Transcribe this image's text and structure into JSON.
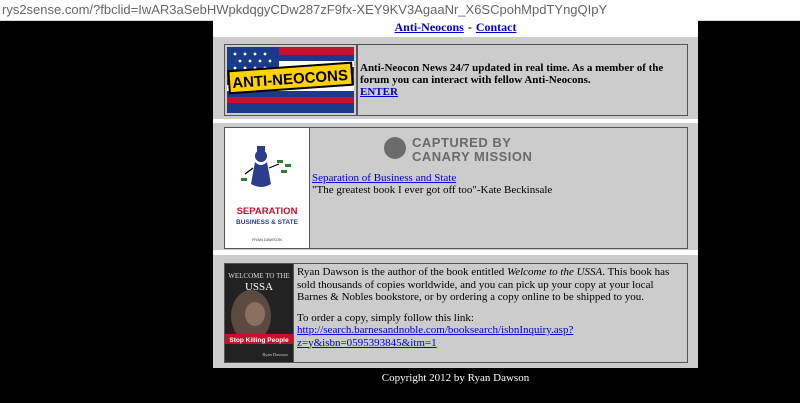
{
  "browser": {
    "url": "rys2sense.com/?fbclid=IwAR3aSebHWpkdqgyCDw287zF9fx-XEY9KV3AgaaNr_X6SCpohMpdTYngQIpY"
  },
  "nav": {
    "links": [
      "Anti-Neocons",
      "Contact"
    ],
    "separator": "-"
  },
  "section1": {
    "logo_text": "ANTI-NEOCONS",
    "description": "Anti-Neocon News 24/7 updated in real time. As a member of the forum you can interact with fellow Anti-Neocons.",
    "enter_link": "ENTER"
  },
  "section2": {
    "watermark_line1": "CAPTURED BY",
    "watermark_line2": "CANARY MISSION",
    "book_link": "Separation of Business and State",
    "quote": "\"The greatest book I ever got off too\"-Kate Beckinsale",
    "cover_title_line1": "SEPARATION",
    "cover_title_line2": "BUSINESS & STATE",
    "cover_author": "RYAN DAWSON"
  },
  "section3": {
    "text_before": "Ryan Dawson is the author of the book entitled ",
    "book_title": "Welcome to the USSA",
    "text_after": ". This book has sold thousands of copies worldwide, and you can pick up your copy at your local Barnes & Nobles bookstore, or by ordering a copy online to be shipped to you.",
    "order_text": "To order a copy, simply follow this link:",
    "order_link": "http://search.barnesandnoble.com/booksearch/isbnInquiry.asp?z=y&isbn=0595393845&itm=1",
    "cover_title_line1": "WELCOME TO THE",
    "cover_title_line2": "USSA",
    "cover_banner": "Stop Killing People",
    "cover_author": "Ryan Dawson"
  },
  "footer": {
    "copyright": "Copyright 2012 by Ryan Dawson"
  },
  "colors": {
    "background": "#000000",
    "panel": "#cccccc",
    "link": "#0000cc",
    "footer_text": "#ffffff"
  }
}
